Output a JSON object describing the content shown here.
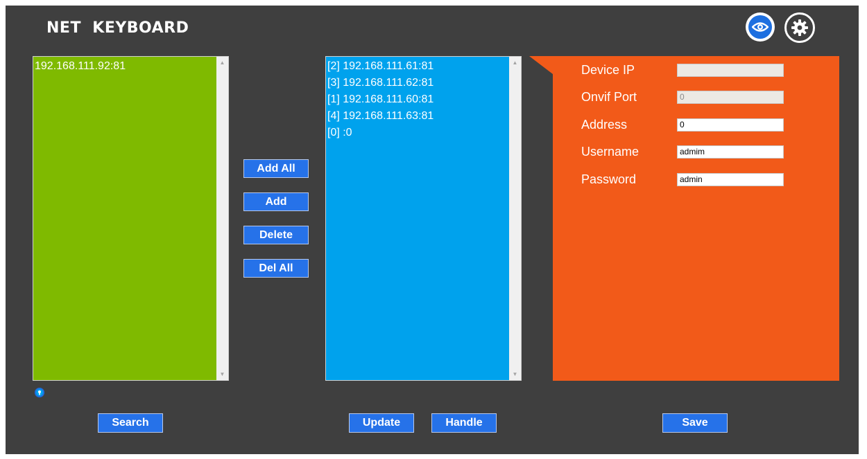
{
  "app": {
    "title": "NET  KEYBOARD"
  },
  "colors": {
    "background": "#3f3f3f",
    "found_list": "#7fba00",
    "added_list": "#00a2ed",
    "settings_panel": "#f25a19",
    "button": "#2672e9"
  },
  "header": {
    "icons": [
      "eye-icon",
      "gear-icon"
    ]
  },
  "found_devices": {
    "items": [
      "192.168.111.92:81"
    ]
  },
  "transfer_buttons": {
    "add_all": "Add All",
    "add": "Add",
    "delete": "Delete",
    "del_all": "Del All"
  },
  "added_devices": {
    "items": [
      "[2] 192.168.111.61:81",
      "[3] 192.168.111.62:81",
      "[1] 192.168.111.60:81",
      "[4] 192.168.111.63:81",
      "[0] :0"
    ]
  },
  "device_form": {
    "device_ip": {
      "label": "Device IP",
      "value": ""
    },
    "onvif_port": {
      "label": "Onvif Port",
      "value": "0"
    },
    "address": {
      "label": "Address",
      "value": "0"
    },
    "username": {
      "label": "Username",
      "value": "admim"
    },
    "password": {
      "label": "Password",
      "value": "admin"
    }
  },
  "bottom_buttons": {
    "search": "Search",
    "update": "Update",
    "handle": "Handle",
    "save": "Save"
  }
}
